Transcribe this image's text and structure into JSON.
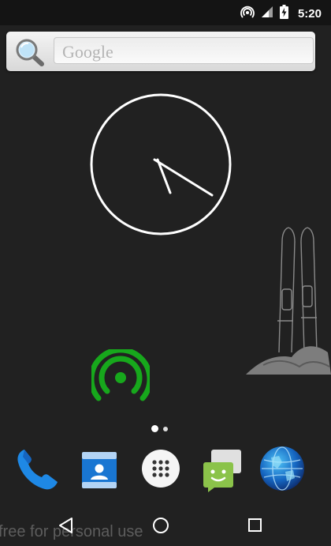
{
  "status_bar": {
    "time": "5:20",
    "icons": [
      "hotspot-icon",
      "signal-icon",
      "battery-charging-icon"
    ]
  },
  "search_widget": {
    "placeholder": "Google",
    "icon": "search-icon"
  },
  "clock": {
    "type": "analog",
    "time": "5:20"
  },
  "home": {
    "app_icon": "hotspot-app-icon",
    "page_count": 2,
    "current_page": 1
  },
  "dock": [
    {
      "name": "phone",
      "icon": "phone-icon"
    },
    {
      "name": "contacts",
      "icon": "contacts-icon"
    },
    {
      "name": "app-drawer",
      "icon": "apps-icon"
    },
    {
      "name": "messaging",
      "icon": "messaging-icon"
    },
    {
      "name": "browser",
      "icon": "globe-icon"
    }
  ],
  "nav_bar": [
    "back-icon",
    "home-icon",
    "recents-icon"
  ],
  "watermark": "free for personal use",
  "colors": {
    "background": "#212121",
    "status_bar": "#141414",
    "hotspot_green": "#17a81c",
    "phone_blue": "#1e88e5",
    "messaging_green": "#8bc34a"
  }
}
